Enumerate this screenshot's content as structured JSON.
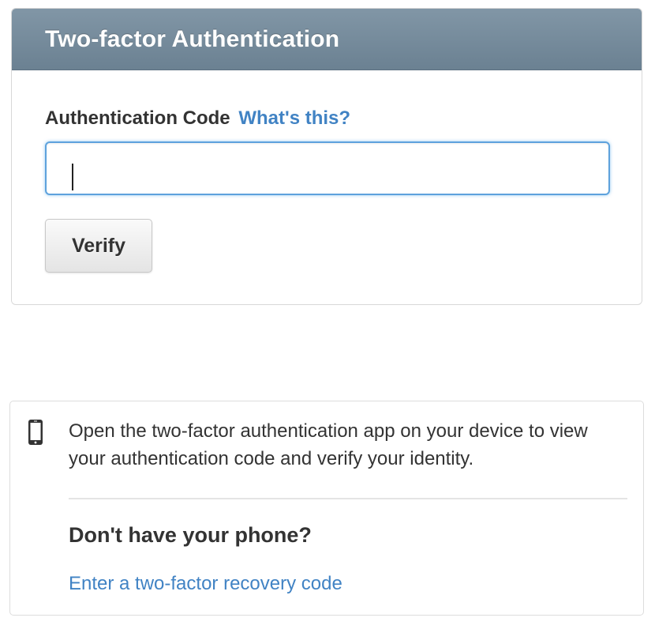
{
  "auth": {
    "title": "Two-factor Authentication",
    "code_label": "Authentication Code",
    "help_link": "What's this?",
    "code_value": "",
    "verify_label": "Verify"
  },
  "info": {
    "icon": "mobile-phone-icon",
    "text": "Open the two-factor authentication app on your device to view your authentication code and verify your identity.",
    "no_phone_heading": "Don't have your phone?",
    "recovery_link": "Enter a two-factor recovery code"
  },
  "colors": {
    "header_bg": "#778c9c",
    "link": "#4183c4",
    "focus_border": "#5ea2dd",
    "text": "#333333"
  }
}
